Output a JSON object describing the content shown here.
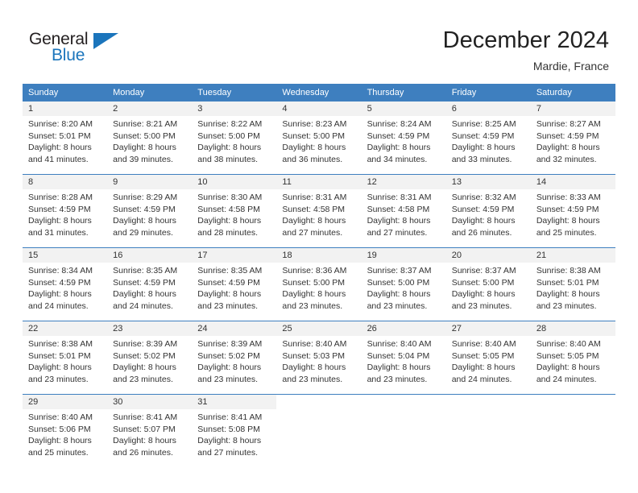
{
  "brand": {
    "name_part1": "General",
    "name_part2": "Blue",
    "triangle_color": "#1b75bc",
    "text_color": "#231f20"
  },
  "header": {
    "title": "December 2024",
    "subtitle": "Mardie, France"
  },
  "theme": {
    "header_bg": "#3e7fbf",
    "header_text": "#ffffff",
    "daynum_bg": "#f2f2f2",
    "body_text": "#333333"
  },
  "weekday_headers": [
    "Sunday",
    "Monday",
    "Tuesday",
    "Wednesday",
    "Thursday",
    "Friday",
    "Saturday"
  ],
  "weeks": [
    [
      {
        "day": "1",
        "sunrise": "Sunrise: 8:20 AM",
        "sunset": "Sunset: 5:01 PM",
        "daylight_line1": "Daylight: 8 hours",
        "daylight_line2": "and 41 minutes."
      },
      {
        "day": "2",
        "sunrise": "Sunrise: 8:21 AM",
        "sunset": "Sunset: 5:00 PM",
        "daylight_line1": "Daylight: 8 hours",
        "daylight_line2": "and 39 minutes."
      },
      {
        "day": "3",
        "sunrise": "Sunrise: 8:22 AM",
        "sunset": "Sunset: 5:00 PM",
        "daylight_line1": "Daylight: 8 hours",
        "daylight_line2": "and 38 minutes."
      },
      {
        "day": "4",
        "sunrise": "Sunrise: 8:23 AM",
        "sunset": "Sunset: 5:00 PM",
        "daylight_line1": "Daylight: 8 hours",
        "daylight_line2": "and 36 minutes."
      },
      {
        "day": "5",
        "sunrise": "Sunrise: 8:24 AM",
        "sunset": "Sunset: 4:59 PM",
        "daylight_line1": "Daylight: 8 hours",
        "daylight_line2": "and 34 minutes."
      },
      {
        "day": "6",
        "sunrise": "Sunrise: 8:25 AM",
        "sunset": "Sunset: 4:59 PM",
        "daylight_line1": "Daylight: 8 hours",
        "daylight_line2": "and 33 minutes."
      },
      {
        "day": "7",
        "sunrise": "Sunrise: 8:27 AM",
        "sunset": "Sunset: 4:59 PM",
        "daylight_line1": "Daylight: 8 hours",
        "daylight_line2": "and 32 minutes."
      }
    ],
    [
      {
        "day": "8",
        "sunrise": "Sunrise: 8:28 AM",
        "sunset": "Sunset: 4:59 PM",
        "daylight_line1": "Daylight: 8 hours",
        "daylight_line2": "and 31 minutes."
      },
      {
        "day": "9",
        "sunrise": "Sunrise: 8:29 AM",
        "sunset": "Sunset: 4:59 PM",
        "daylight_line1": "Daylight: 8 hours",
        "daylight_line2": "and 29 minutes."
      },
      {
        "day": "10",
        "sunrise": "Sunrise: 8:30 AM",
        "sunset": "Sunset: 4:58 PM",
        "daylight_line1": "Daylight: 8 hours",
        "daylight_line2": "and 28 minutes."
      },
      {
        "day": "11",
        "sunrise": "Sunrise: 8:31 AM",
        "sunset": "Sunset: 4:58 PM",
        "daylight_line1": "Daylight: 8 hours",
        "daylight_line2": "and 27 minutes."
      },
      {
        "day": "12",
        "sunrise": "Sunrise: 8:31 AM",
        "sunset": "Sunset: 4:58 PM",
        "daylight_line1": "Daylight: 8 hours",
        "daylight_line2": "and 27 minutes."
      },
      {
        "day": "13",
        "sunrise": "Sunrise: 8:32 AM",
        "sunset": "Sunset: 4:59 PM",
        "daylight_line1": "Daylight: 8 hours",
        "daylight_line2": "and 26 minutes."
      },
      {
        "day": "14",
        "sunrise": "Sunrise: 8:33 AM",
        "sunset": "Sunset: 4:59 PM",
        "daylight_line1": "Daylight: 8 hours",
        "daylight_line2": "and 25 minutes."
      }
    ],
    [
      {
        "day": "15",
        "sunrise": "Sunrise: 8:34 AM",
        "sunset": "Sunset: 4:59 PM",
        "daylight_line1": "Daylight: 8 hours",
        "daylight_line2": "and 24 minutes."
      },
      {
        "day": "16",
        "sunrise": "Sunrise: 8:35 AM",
        "sunset": "Sunset: 4:59 PM",
        "daylight_line1": "Daylight: 8 hours",
        "daylight_line2": "and 24 minutes."
      },
      {
        "day": "17",
        "sunrise": "Sunrise: 8:35 AM",
        "sunset": "Sunset: 4:59 PM",
        "daylight_line1": "Daylight: 8 hours",
        "daylight_line2": "and 23 minutes."
      },
      {
        "day": "18",
        "sunrise": "Sunrise: 8:36 AM",
        "sunset": "Sunset: 5:00 PM",
        "daylight_line1": "Daylight: 8 hours",
        "daylight_line2": "and 23 minutes."
      },
      {
        "day": "19",
        "sunrise": "Sunrise: 8:37 AM",
        "sunset": "Sunset: 5:00 PM",
        "daylight_line1": "Daylight: 8 hours",
        "daylight_line2": "and 23 minutes."
      },
      {
        "day": "20",
        "sunrise": "Sunrise: 8:37 AM",
        "sunset": "Sunset: 5:00 PM",
        "daylight_line1": "Daylight: 8 hours",
        "daylight_line2": "and 23 minutes."
      },
      {
        "day": "21",
        "sunrise": "Sunrise: 8:38 AM",
        "sunset": "Sunset: 5:01 PM",
        "daylight_line1": "Daylight: 8 hours",
        "daylight_line2": "and 23 minutes."
      }
    ],
    [
      {
        "day": "22",
        "sunrise": "Sunrise: 8:38 AM",
        "sunset": "Sunset: 5:01 PM",
        "daylight_line1": "Daylight: 8 hours",
        "daylight_line2": "and 23 minutes."
      },
      {
        "day": "23",
        "sunrise": "Sunrise: 8:39 AM",
        "sunset": "Sunset: 5:02 PM",
        "daylight_line1": "Daylight: 8 hours",
        "daylight_line2": "and 23 minutes."
      },
      {
        "day": "24",
        "sunrise": "Sunrise: 8:39 AM",
        "sunset": "Sunset: 5:02 PM",
        "daylight_line1": "Daylight: 8 hours",
        "daylight_line2": "and 23 minutes."
      },
      {
        "day": "25",
        "sunrise": "Sunrise: 8:40 AM",
        "sunset": "Sunset: 5:03 PM",
        "daylight_line1": "Daylight: 8 hours",
        "daylight_line2": "and 23 minutes."
      },
      {
        "day": "26",
        "sunrise": "Sunrise: 8:40 AM",
        "sunset": "Sunset: 5:04 PM",
        "daylight_line1": "Daylight: 8 hours",
        "daylight_line2": "and 23 minutes."
      },
      {
        "day": "27",
        "sunrise": "Sunrise: 8:40 AM",
        "sunset": "Sunset: 5:05 PM",
        "daylight_line1": "Daylight: 8 hours",
        "daylight_line2": "and 24 minutes."
      },
      {
        "day": "28",
        "sunrise": "Sunrise: 8:40 AM",
        "sunset": "Sunset: 5:05 PM",
        "daylight_line1": "Daylight: 8 hours",
        "daylight_line2": "and 24 minutes."
      }
    ],
    [
      {
        "day": "29",
        "sunrise": "Sunrise: 8:40 AM",
        "sunset": "Sunset: 5:06 PM",
        "daylight_line1": "Daylight: 8 hours",
        "daylight_line2": "and 25 minutes."
      },
      {
        "day": "30",
        "sunrise": "Sunrise: 8:41 AM",
        "sunset": "Sunset: 5:07 PM",
        "daylight_line1": "Daylight: 8 hours",
        "daylight_line2": "and 26 minutes."
      },
      {
        "day": "31",
        "sunrise": "Sunrise: 8:41 AM",
        "sunset": "Sunset: 5:08 PM",
        "daylight_line1": "Daylight: 8 hours",
        "daylight_line2": "and 27 minutes."
      },
      {
        "day": "",
        "sunrise": "",
        "sunset": "",
        "daylight_line1": "",
        "daylight_line2": ""
      },
      {
        "day": "",
        "sunrise": "",
        "sunset": "",
        "daylight_line1": "",
        "daylight_line2": ""
      },
      {
        "day": "",
        "sunrise": "",
        "sunset": "",
        "daylight_line1": "",
        "daylight_line2": ""
      },
      {
        "day": "",
        "sunrise": "",
        "sunset": "",
        "daylight_line1": "",
        "daylight_line2": ""
      }
    ]
  ]
}
